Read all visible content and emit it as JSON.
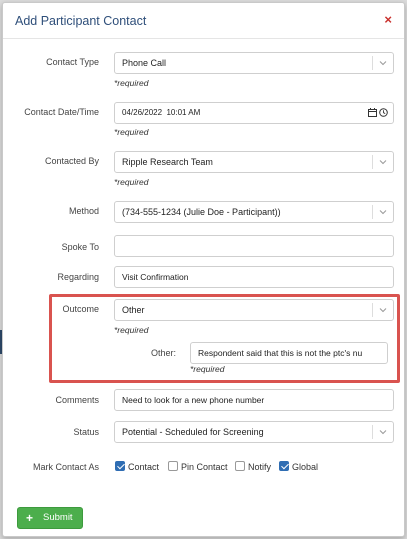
{
  "modal": {
    "title": "Add Participant Contact",
    "close_label": "×"
  },
  "required_text": "*required",
  "fields": {
    "contact_type": {
      "label": "Contact Type",
      "value": "Phone Call"
    },
    "contact_datetime": {
      "label": "Contact Date/Time",
      "value": "04/26/2022  10:01 AM"
    },
    "contacted_by": {
      "label": "Contacted By",
      "value": "Ripple Research Team"
    },
    "method": {
      "label": "Method",
      "value": "(734-555-1234 (Julie Doe - Participant))"
    },
    "spoke_to": {
      "label": "Spoke To",
      "value": ""
    },
    "regarding": {
      "label": "Regarding",
      "value": "Visit Confirmation"
    },
    "outcome": {
      "label": "Outcome",
      "value": "Other"
    },
    "other": {
      "label": "Other:",
      "value": "Respondent said that this is not the ptc's nu"
    },
    "comments": {
      "label": "Comments",
      "value": "Need to look for a new phone number"
    },
    "status": {
      "label": "Status",
      "value": "Potential - Scheduled for Screening"
    }
  },
  "mark_contact_as": {
    "label": "Mark Contact As",
    "options": [
      {
        "label": "Contact",
        "checked": true
      },
      {
        "label": "Pin Contact",
        "checked": false
      },
      {
        "label": "Notify",
        "checked": false
      },
      {
        "label": "Global",
        "checked": true
      }
    ]
  },
  "submit": {
    "label": "Submit"
  },
  "colors": {
    "accent": "#2f6db3",
    "title": "#2f4f7a",
    "submit": "#4cae4c",
    "highlight": "#d9534f"
  }
}
